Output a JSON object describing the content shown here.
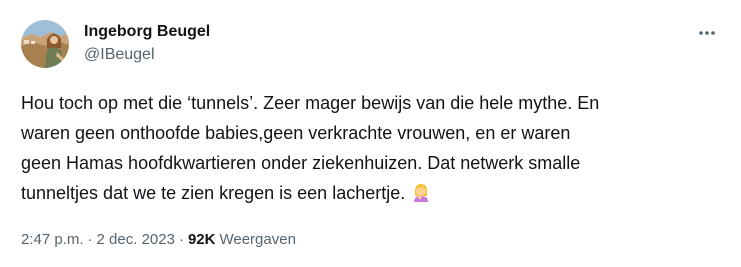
{
  "author": {
    "display_name": "Ingeborg Beugel",
    "handle": "@IBeugel"
  },
  "tweet": {
    "text": "Hou toch op met die ‘tunnels’. Zeer mager bewijs van die hele mythe. En\nwaren geen onthoofde babies,geen verkrachte vrouwen, en er waren\ngeen Hamas hoofdkwartieren onder ziekenhuizen. Dat netwerk smalle\ntunneltjes dat we te zien kregen is een lachertje.",
    "emoji": "woman-facepalming-emoji"
  },
  "meta": {
    "time": "2:47 p.m.",
    "separator_1": "·",
    "date": "2 dec. 2023",
    "separator_2": "·",
    "views_count": "92K",
    "views_label": "Weergaven"
  },
  "icons": {
    "more": "more-options-icon"
  },
  "colors": {
    "text_primary": "#0f1419",
    "text_secondary": "#536471",
    "background": "#ffffff"
  }
}
